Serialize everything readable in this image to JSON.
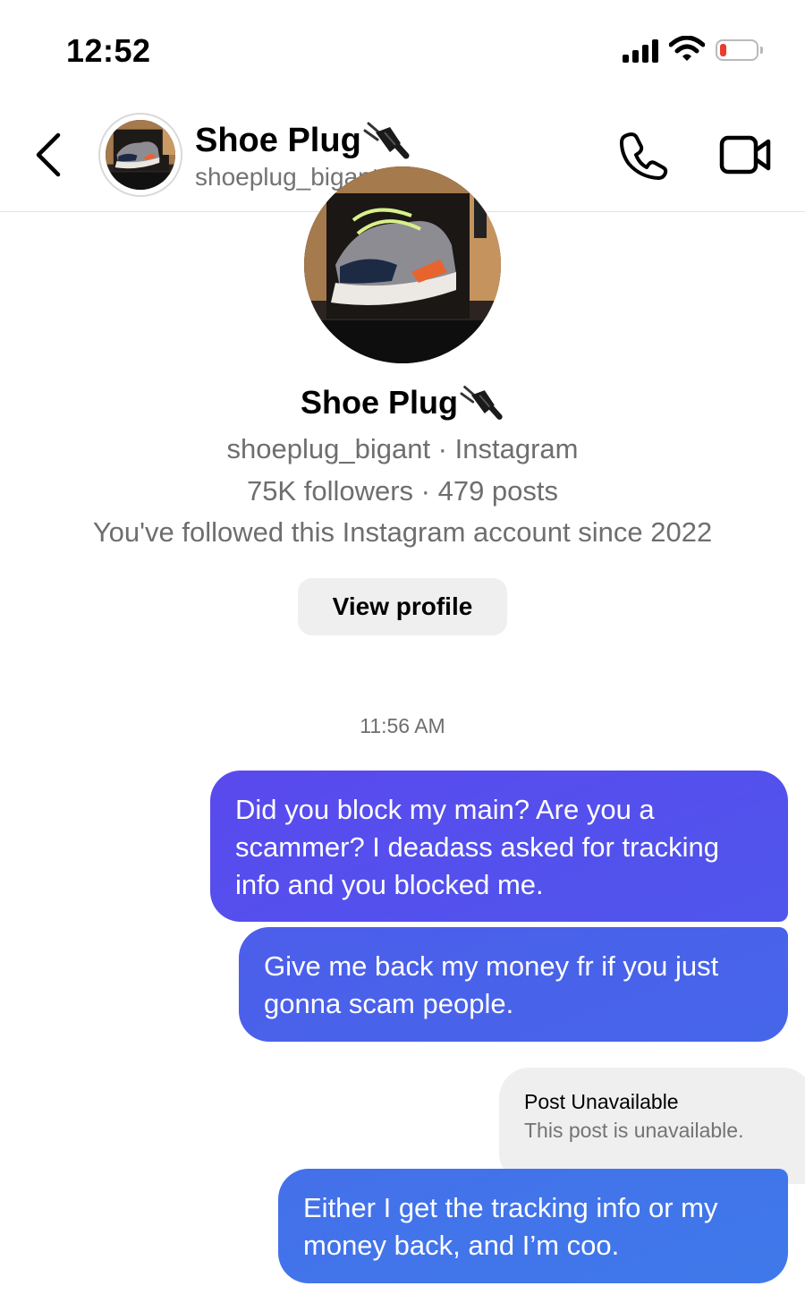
{
  "status_bar": {
    "time": "12:52",
    "battery_color": "#ea3b2f"
  },
  "header": {
    "name": "Shoe Plug",
    "name_emoji": "plug-icon",
    "handle": "shoeplug_bigant",
    "back_icon": "chevron-left-icon",
    "call_icon": "phone-icon",
    "video_icon": "video-camera-icon"
  },
  "profile": {
    "name": "Shoe Plug",
    "line1": "shoeplug_bigant · Instagram",
    "line2": "75K followers · 479 posts",
    "line3": "You've followed this Instagram account since 2022",
    "view_profile_label": "View profile"
  },
  "conversation": {
    "timestamp": "11:56 AM",
    "messages": [
      {
        "sender": "me",
        "text": "Did you block my main? Are you a scammer? I deadass asked for tracking info and you blocked me."
      },
      {
        "sender": "me",
        "text": "Give me back my money fr if you just gonna scam people."
      },
      {
        "sender": "them",
        "type": "post",
        "title": "Post Unavailable",
        "subtitle": "This post is unavailable."
      },
      {
        "sender": "me",
        "text": "Either I get the tracking info or my money back, and I’m coo."
      }
    ]
  },
  "colors": {
    "bubble_top": "#5a49ee",
    "bubble_bottom": "#3f79ea",
    "incoming_bubble": "#efefef"
  }
}
